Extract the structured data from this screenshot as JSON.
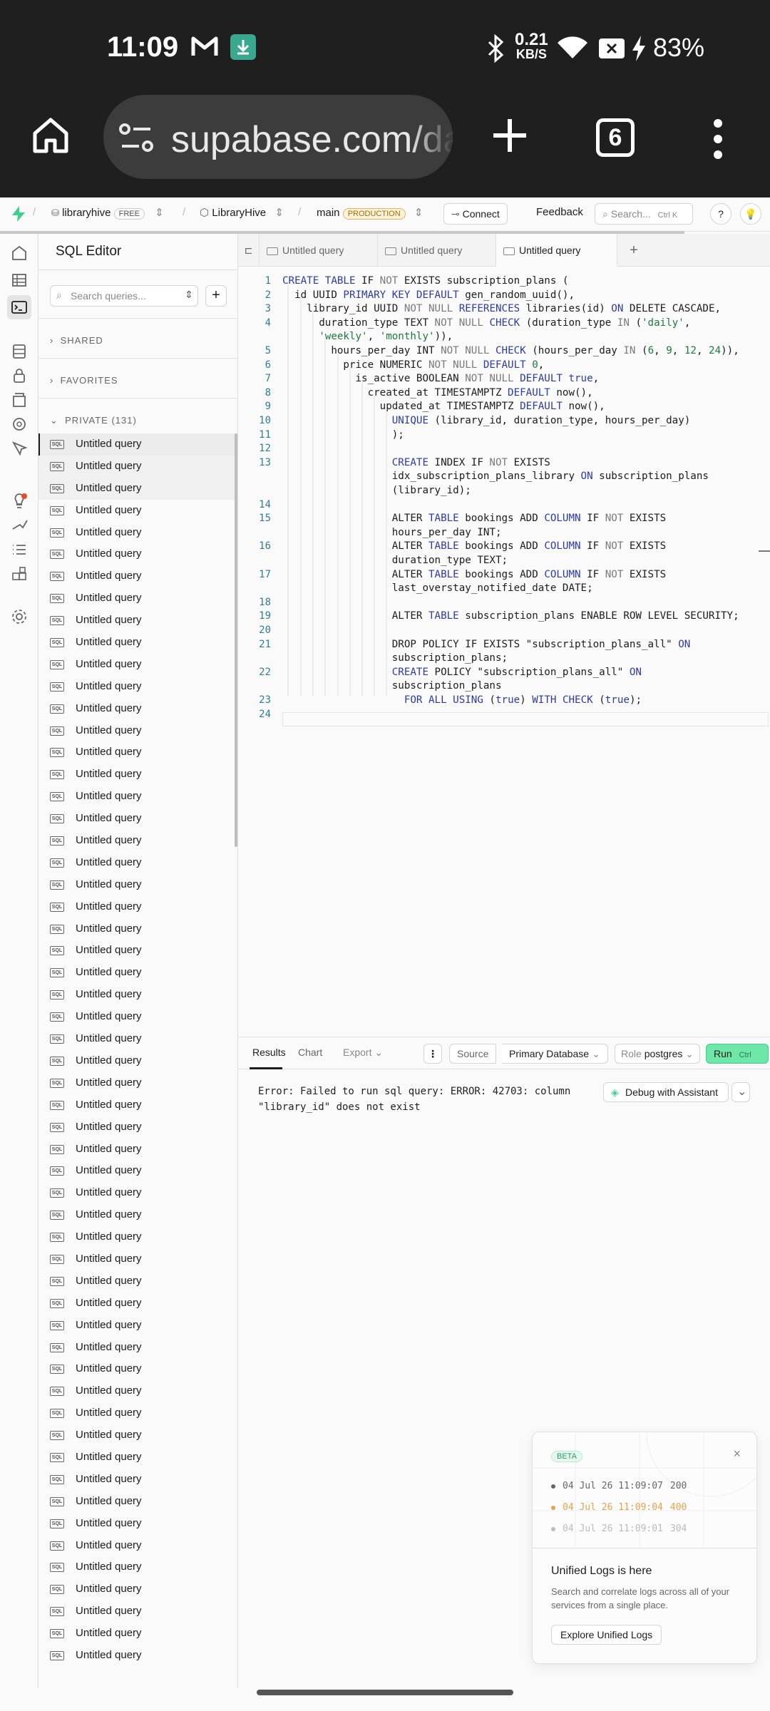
{
  "status_bar": {
    "time": "11:09",
    "net_speed_value": "0.21",
    "net_speed_unit": "KB/S",
    "battery": "83%"
  },
  "browser": {
    "url": "supabase.com/da",
    "tab_count": "6"
  },
  "header": {
    "org": "libraryhive",
    "org_badge": "FREE",
    "project": "LibraryHive",
    "branch": "main",
    "branch_badge": "PRODUCTION",
    "connect_label": "Connect",
    "feedback_label": "Feedback",
    "search_placeholder": "Search...",
    "search_shortcut": "Ctrl K"
  },
  "sidebar": {
    "title": "SQL Editor",
    "search_placeholder": "Search queries...",
    "sections": {
      "shared": "SHARED",
      "favorites": "FAVORITES",
      "private": "PRIVATE (131)"
    },
    "query_label": "Untitled query",
    "sql_icon_text": "SQL"
  },
  "editor": {
    "tabs": [
      "Untitled query",
      "Untitled query",
      "Untitled query"
    ],
    "code_lines": [
      {
        "n": "1",
        "html": "<span class='kw'>CREATE TABLE</span> IF <span class='kw2'>NOT</span> EXISTS subscription_plans ("
      },
      {
        "n": "2",
        "html": "  id UUID <span class='kw'>PRIMARY KEY DEFAULT</span> gen_random_uuid(),"
      },
      {
        "n": "3",
        "html": "    library_id UUID <span class='kw2'>NOT NULL</span> <span class='kw'>REFERENCES</span> libraries(id) <span class='kw'>ON</span> DELETE CASCADE,"
      },
      {
        "n": "4",
        "html": "      duration_type TEXT <span class='kw2'>NOT NULL</span> <span class='kw'>CHECK</span> (duration_type <span class='kw2'>IN</span> (<span class='str'>'daily'</span>,"
      },
      {
        "n": "",
        "html": "      <span class='str'>'weekly'</span>, <span class='str'>'monthly'</span>)),"
      },
      {
        "n": "5",
        "html": "        hours_per_day INT <span class='kw2'>NOT NULL</span> <span class='kw'>CHECK</span> (hours_per_day <span class='kw2'>IN</span> (<span class='num'>6</span>, <span class='num'>9</span>, <span class='num'>12</span>, <span class='num'>24</span>)),"
      },
      {
        "n": "6",
        "html": "          price NUMERIC <span class='kw2'>NOT NULL</span> <span class='kw'>DEFAULT</span> <span class='num'>0</span>,"
      },
      {
        "n": "7",
        "html": "            is_active BOOLEAN <span class='kw2'>NOT NULL</span> <span class='kw'>DEFAULT true</span>,"
      },
      {
        "n": "8",
        "html": "              created_at TIMESTAMPTZ <span class='kw'>DEFAULT</span> now(),"
      },
      {
        "n": "9",
        "html": "                updated_at TIMESTAMPTZ <span class='kw'>DEFAULT</span> now(),"
      },
      {
        "n": "10",
        "html": "                  <span class='kw'>UNIQUE</span> (library_id, duration_type, hours_per_day)"
      },
      {
        "n": "11",
        "html": "                  );"
      },
      {
        "n": "12",
        "html": ""
      },
      {
        "n": "13",
        "html": "                  <span class='kw'>CREATE</span> INDEX IF <span class='kw2'>NOT</span> EXISTS"
      },
      {
        "n": "",
        "html": "                  idx_subscription_plans_library <span class='kw'>ON</span> subscription_plans"
      },
      {
        "n": "",
        "html": "                  (library_id);"
      },
      {
        "n": "14",
        "html": ""
      },
      {
        "n": "15",
        "html": "                  ALTER <span class='kw'>TABLE</span> bookings ADD <span class='kw'>COLUMN</span> IF <span class='kw2'>NOT</span> EXISTS"
      },
      {
        "n": "",
        "html": "                  hours_per_day INT;"
      },
      {
        "n": "16",
        "html": "                  ALTER <span class='kw'>TABLE</span> bookings ADD <span class='kw'>COLUMN</span> IF <span class='kw2'>NOT</span> EXISTS"
      },
      {
        "n": "",
        "html": "                  duration_type TEXT;"
      },
      {
        "n": "17",
        "html": "                  ALTER <span class='kw'>TABLE</span> bookings ADD <span class='kw'>COLUMN</span> IF <span class='kw2'>NOT</span> EXISTS"
      },
      {
        "n": "",
        "html": "                  last_overstay_notified_date DATE;"
      },
      {
        "n": "18",
        "html": ""
      },
      {
        "n": "19",
        "html": "                  ALTER <span class='kw'>TABLE</span> subscription_plans ENABLE ROW LEVEL SECURITY;"
      },
      {
        "n": "20",
        "html": ""
      },
      {
        "n": "21",
        "html": "                  DROP POLICY IF EXISTS <span class='fn'>\"subscription_plans_all\"</span> <span class='kw'>ON</span>"
      },
      {
        "n": "",
        "html": "                  subscription_plans;"
      },
      {
        "n": "22",
        "html": "                  <span class='kw'>CREATE</span> POLICY <span class='fn'>\"subscription_plans_all\"</span> <span class='kw'>ON</span>"
      },
      {
        "n": "",
        "html": "                  subscription_plans"
      },
      {
        "n": "23",
        "html": "                    <span class='kw'>FOR ALL USING</span> (<span class='kw'>true</span>) <span class='kw'>WITH CHECK</span> (<span class='kw'>true</span>);"
      },
      {
        "n": "24",
        "html": ""
      }
    ]
  },
  "results": {
    "tabs": {
      "results": "Results",
      "chart": "Chart",
      "export": "Export"
    },
    "source_label": "Source",
    "database_label": "Primary Database",
    "role_label": "Role",
    "role_value": "postgres",
    "run_label": "Run",
    "run_shortcut": "Ctrl",
    "error_text": "Error: Failed to run sql query: ERROR: 42703: column \"library_id\" does not exist",
    "debug_label": "Debug with Assistant"
  },
  "popup": {
    "badge": "BETA",
    "logs": [
      {
        "time": "04 Jul 26 11:09:07",
        "code": "200",
        "color": "#666666"
      },
      {
        "time": "04 Jul 26 11:09:04",
        "code": "400",
        "color": "#e3a14b"
      },
      {
        "time": "04 Jul 26 11:09:01",
        "code": "304",
        "color": "#bbbbbb"
      }
    ],
    "title": "Unified Logs is here",
    "description": "Search and correlate logs across all of your services from a single place.",
    "button_label": "Explore Unified Logs"
  },
  "colors": {
    "brand": "#3ecf8e",
    "run_button": "#6ee7a8",
    "production_badge": "#fdf3dc"
  }
}
